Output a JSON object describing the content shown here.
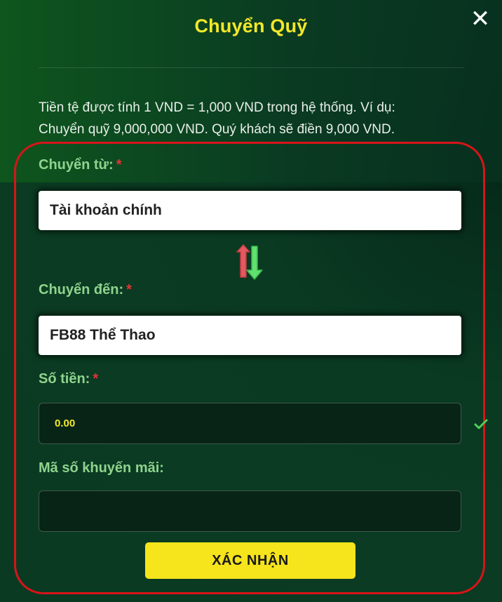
{
  "dialog": {
    "title": "Chuyển Quỹ",
    "close_icon": "close-icon"
  },
  "description": {
    "line1": "Tiền tệ được tính 1 VND = 1,000 VND trong hệ thống. Ví dụ:",
    "line2": "Chuyển quỹ 9,000,000 VND. Quý khách sẽ điền 9,000 VND."
  },
  "form": {
    "from": {
      "label": "Chuyển từ:",
      "required_mark": "*",
      "value": "Tài khoản chính"
    },
    "swap_icon": "swap-arrows-icon",
    "to": {
      "label": "Chuyển đến:",
      "required_mark": "*",
      "value": "FB88 Thể Thao"
    },
    "amount": {
      "label": "Số tiền:",
      "required_mark": "*",
      "value": "0.00"
    },
    "promo": {
      "label": "Mã số khuyến mãi:",
      "value": ""
    },
    "confirm_label": "XÁC NHẬN"
  },
  "colors": {
    "accent_yellow": "#f2e82a",
    "label_green": "#8fd38e",
    "required_red": "#e53232",
    "frame_red": "#d8141a",
    "button_yellow": "#f6e41c"
  }
}
